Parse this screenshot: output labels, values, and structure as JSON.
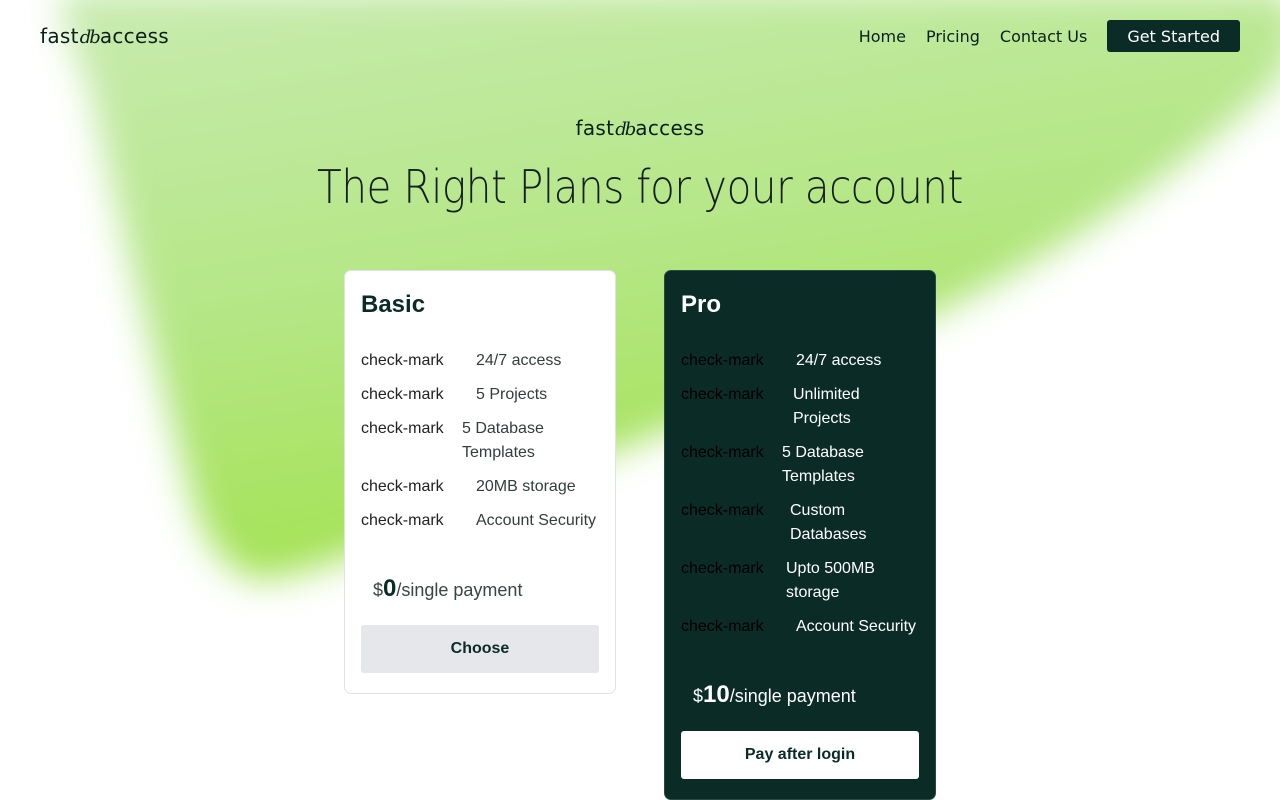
{
  "brand": {
    "logo_left": "fast",
    "logo_mid": "db",
    "logo_right": "access"
  },
  "nav": {
    "links": [
      "Home",
      "Pricing",
      "Contact Us"
    ],
    "cta_label": "Get Started"
  },
  "hero": {
    "title": "The Right Plans for your account"
  },
  "colors": {
    "accent": "#0b2b26",
    "backdrop_green": "#a4e35a",
    "backdrop_light": "#c8ebb0"
  },
  "plans": [
    {
      "name": "Basic",
      "check_alt": "check-mark",
      "features": [
        "24/7 access",
        "5 Projects",
        "5 Database Templates",
        "20MB storage",
        "Account Security"
      ],
      "currency": "$",
      "amount": "0",
      "period": "/single payment",
      "button_label": "Choose"
    },
    {
      "name": "Pro",
      "check_alt": "check-mark",
      "features": [
        "24/7 access",
        "Unlimited Projects",
        "5 Database Templates",
        "Custom Databases",
        "Upto 500MB storage",
        "Account Security"
      ],
      "currency": "$",
      "amount": "10",
      "period": "/single payment",
      "button_label": "Pay after login"
    }
  ]
}
